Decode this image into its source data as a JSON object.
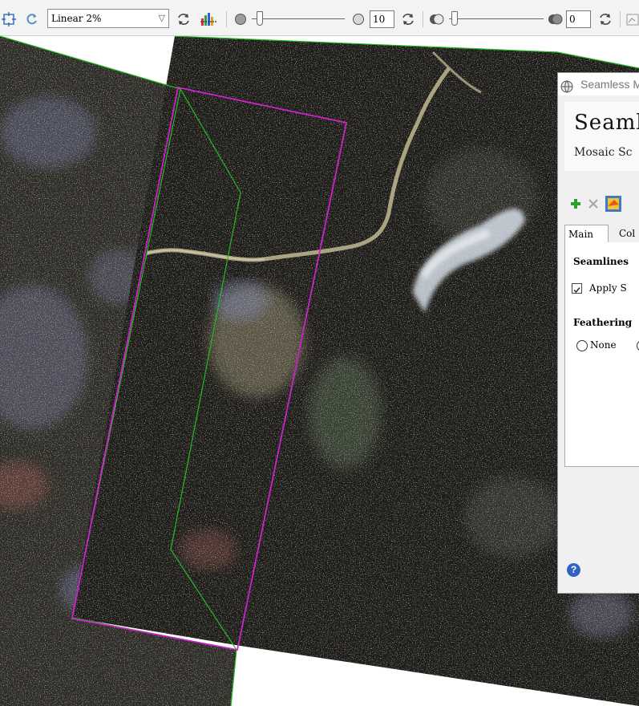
{
  "toolbar": {
    "stretch_value": "Linear 2%",
    "brightness_value": "10",
    "transparency_value": "0"
  },
  "icons": {
    "pan": "pan-icon",
    "reset": "reset-icon",
    "refresh": "refresh-icon",
    "histogram": "histogram-icon",
    "brightness": "brightness-icon",
    "contrast": "contrast-icon",
    "transparency": "transparency-icon"
  },
  "colors": {
    "footprint_outline": "#22bb22",
    "selection_outline": "#cc22cc",
    "dialog_bg": "#f0f0f0",
    "add_icon": "#2aa02a",
    "help_icon": "#2f62c4"
  },
  "dialog": {
    "title": "Seamless M",
    "header_title": "Seamle",
    "header_subtitle": "Mosaic Sc",
    "tabs": [
      "Main",
      "Col"
    ],
    "seamlines_section": "Seamlines",
    "apply_checkbox_label": "Apply S",
    "apply_checked": true,
    "feathering_section": "Feathering",
    "feather_option_none": "None",
    "help_glyph": "?"
  }
}
